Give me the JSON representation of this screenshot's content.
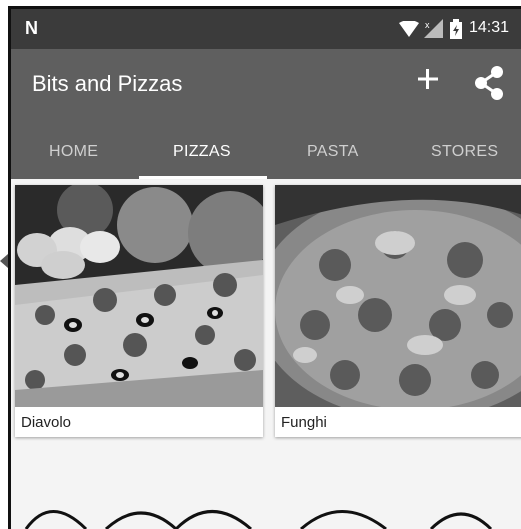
{
  "statusbar": {
    "time": "14:31"
  },
  "appbar": {
    "title": "Bits and Pizzas",
    "add_icon": "plus-icon",
    "share_icon": "share-icon"
  },
  "tabs": [
    {
      "label": "HOME",
      "active": false
    },
    {
      "label": "PIZZAS",
      "active": true
    },
    {
      "label": "PASTA",
      "active": false
    },
    {
      "label": "STORES",
      "active": false
    }
  ],
  "cards": [
    {
      "caption": "Diavolo"
    },
    {
      "caption": "Funghi"
    }
  ]
}
